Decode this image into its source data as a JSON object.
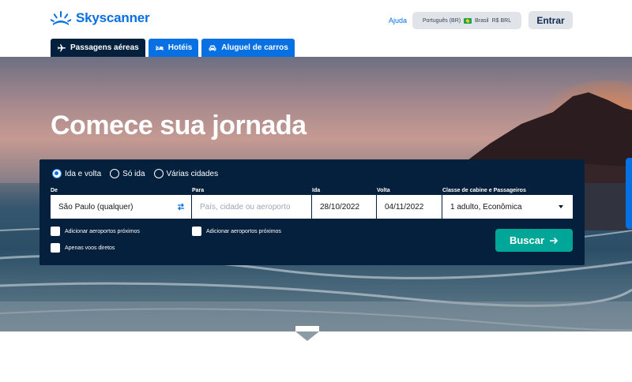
{
  "brand": {
    "name": "Skyscanner",
    "color": "#0770e3"
  },
  "header": {
    "help_label": "Ajuda",
    "locale": {
      "language": "Português (BR)",
      "country": "Brasil",
      "currency": "R$ BRL"
    },
    "login_label": "Entrar"
  },
  "tabs": [
    {
      "label": "Passagens aéreas",
      "icon": "plane-icon",
      "active": true
    },
    {
      "label": "Hotéis",
      "icon": "bed-icon",
      "active": false
    },
    {
      "label": "Aluguel de carros",
      "icon": "car-icon",
      "active": false
    }
  ],
  "hero": {
    "title": "Comece sua jornada"
  },
  "search": {
    "trip_types": [
      {
        "label": "Ida e volta",
        "selected": true
      },
      {
        "label": "Só ida",
        "selected": false
      },
      {
        "label": "Várias cidades",
        "selected": false
      }
    ],
    "from": {
      "label": "De",
      "value": "São Paulo (qualquer)"
    },
    "to": {
      "label": "Para",
      "placeholder": "País, cidade ou aeroporto"
    },
    "depart": {
      "label": "Ida",
      "value": "28/10/2022"
    },
    "return": {
      "label": "Volta",
      "value": "04/11/2022"
    },
    "cabin": {
      "label": "Classe de cabine e Passageiros",
      "value": "1 adulto, Econômica"
    },
    "nearby_from_label": "Adicionar aeroportos próximos",
    "nearby_to_label": "Adicionar aeroportos próximos",
    "direct_only_label": "Apenas voos diretos",
    "submit_label": "Buscar"
  },
  "colors": {
    "panel": "#05203c",
    "accent_teal": "#00a698",
    "tab_blue": "#0770e3"
  }
}
